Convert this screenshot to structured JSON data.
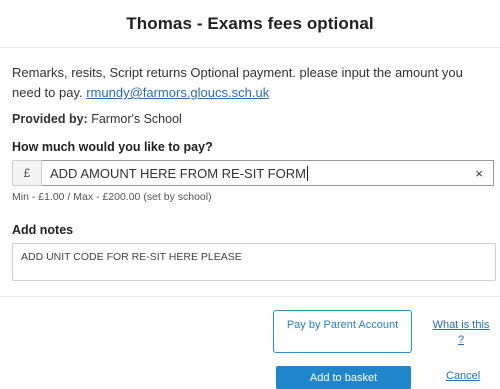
{
  "dialog": {
    "title": "Thomas - Exams fees optional"
  },
  "description": {
    "text": "Remarks, resits, Script returns Optional payment. please input the amount you need to pay. ",
    "email": "rmundy@farmors.gloucs.sch.uk"
  },
  "provider": {
    "label": "Provided by:",
    "name": "Farmor's School"
  },
  "payment": {
    "question": "How much would you like to pay?",
    "currency_symbol": "£",
    "amount_value": "ADD AMOUNT HERE FROM RE-SIT FORM",
    "clear_glyph": "×",
    "limits": "Min - £1.00 / Max - £200.00 (set by school)"
  },
  "notes": {
    "title": "Add notes",
    "value": "ADD UNIT CODE FOR RE-SIT HERE PLEASE"
  },
  "actions": {
    "pay_by_parent_account": "Pay by Parent Account",
    "what_is_this": "What is this ?",
    "add_to_basket": "Add to basket",
    "cancel": "Cancel"
  },
  "colors": {
    "accent": "#2185c9",
    "link": "#2a6db5"
  },
  "icons": {
    "clear": "close-icon"
  }
}
